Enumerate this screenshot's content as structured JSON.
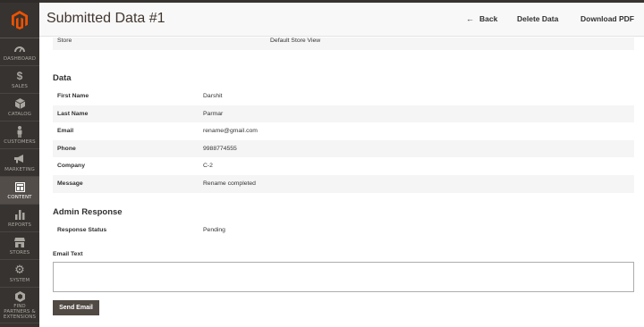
{
  "header": {
    "title": "Submitted Data #1",
    "back_label": "Back",
    "delete_label": "Delete Data",
    "pdf_label": "Download PDF"
  },
  "sidebar": {
    "items": [
      {
        "label": "DASHBOARD",
        "icon": "dashboard-icon"
      },
      {
        "label": "SALES",
        "icon": "dollar-icon"
      },
      {
        "label": "CATALOG",
        "icon": "cube-icon"
      },
      {
        "label": "CUSTOMERS",
        "icon": "person-icon"
      },
      {
        "label": "MARKETING",
        "icon": "megaphone-icon"
      },
      {
        "label": "CONTENT",
        "icon": "layout-icon",
        "active": true
      },
      {
        "label": "REPORTS",
        "icon": "bar-chart-icon"
      },
      {
        "label": "STORES",
        "icon": "store-icon"
      },
      {
        "label": "SYSTEM",
        "icon": "gear-icon"
      },
      {
        "label": "FIND PARTNERS & EXTENSIONS",
        "icon": "extensions-icon"
      }
    ]
  },
  "store": {
    "key": "Store",
    "value": "Default Store View"
  },
  "data_section": {
    "title": "Data",
    "rows": [
      {
        "key": "First Name",
        "value": "Darshit"
      },
      {
        "key": "Last Name",
        "value": "Parmar"
      },
      {
        "key": "Email",
        "value": "rename@gmail.com"
      },
      {
        "key": "Phone",
        "value": "9988774555"
      },
      {
        "key": "Company",
        "value": "C-2"
      },
      {
        "key": "Message",
        "value": "Rename completed"
      }
    ]
  },
  "admin_section": {
    "title": "Admin Response",
    "status_key": "Response Status",
    "status_value": "Pending",
    "email_label": "Email Text",
    "email_value": "",
    "send_label": "Send Email"
  },
  "colors": {
    "sidebar_bg": "#373330",
    "active_bg": "#524d49",
    "logo_orange": "#eb5202",
    "button_bg": "#514943"
  }
}
